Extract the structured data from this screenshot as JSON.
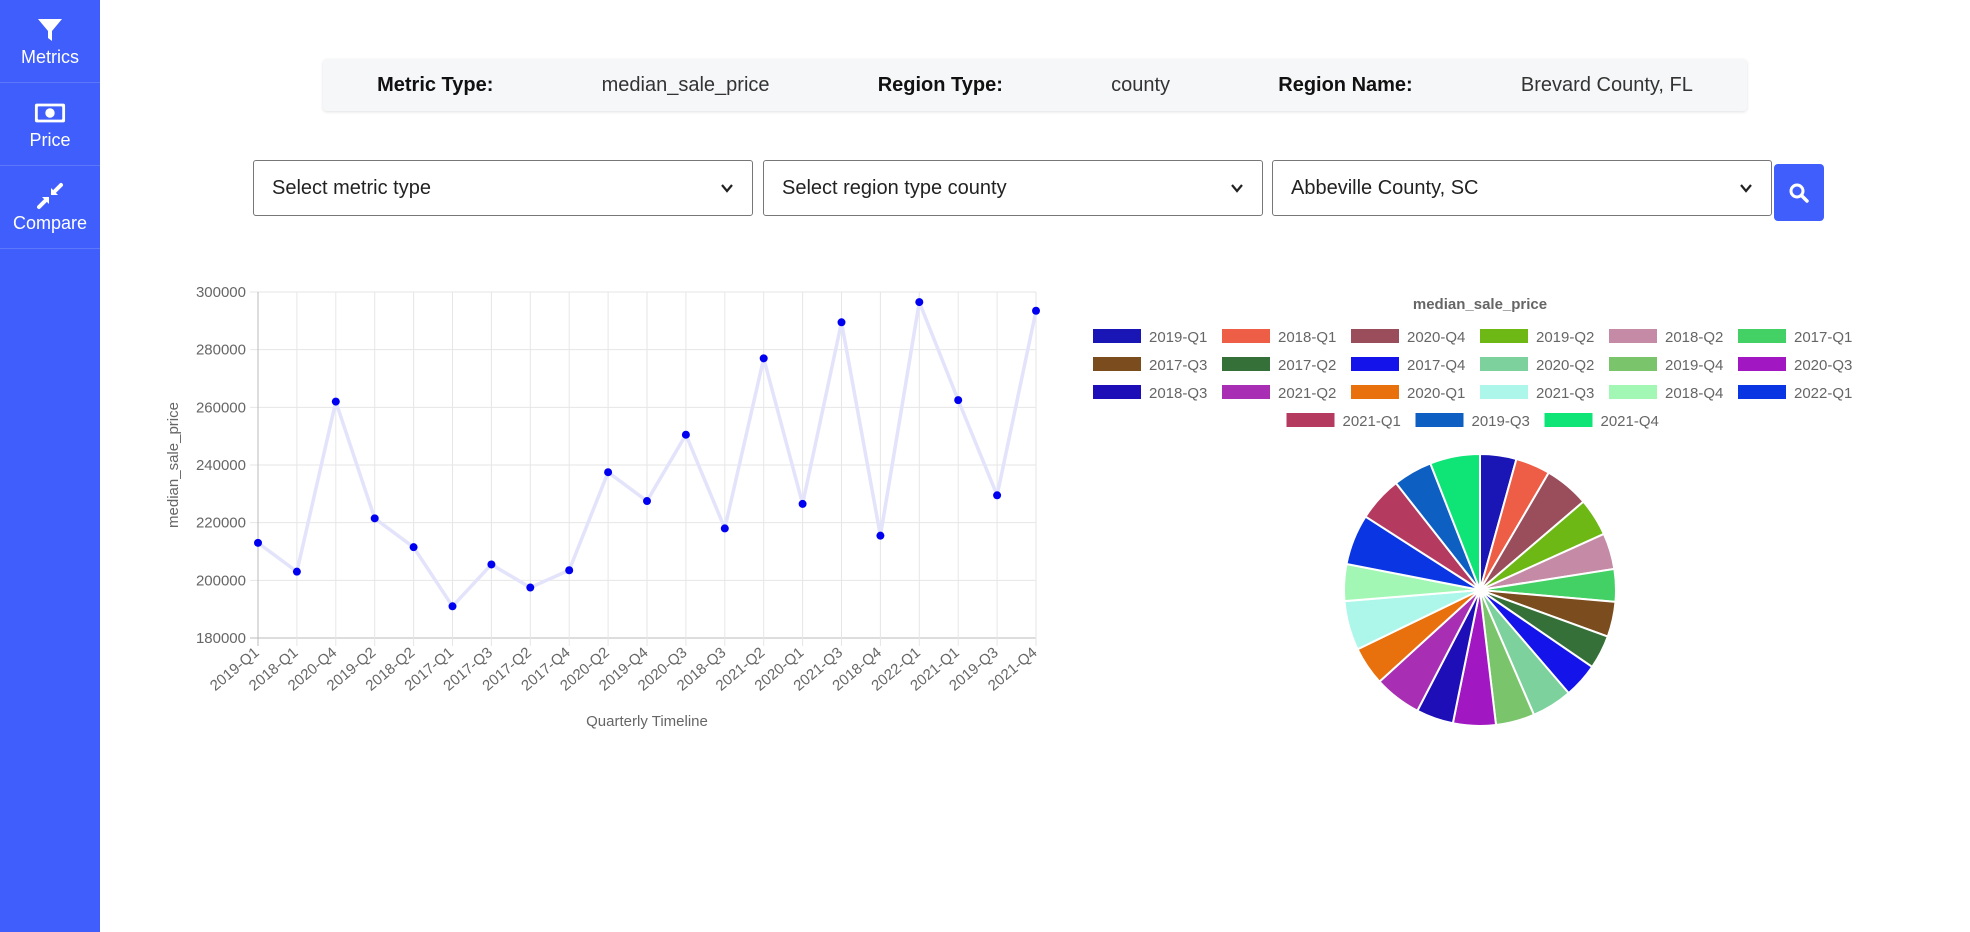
{
  "sidebar": {
    "items": [
      {
        "label": "Metrics",
        "icon": "filter-icon"
      },
      {
        "label": "Price",
        "icon": "money-icon"
      },
      {
        "label": "Compare",
        "icon": "compress-icon"
      }
    ]
  },
  "info": {
    "metric_type_label": "Metric Type:",
    "metric_type_value": "median_sale_price",
    "region_type_label": "Region Type:",
    "region_type_value": "county",
    "region_name_label": "Region Name:",
    "region_name_value": "Brevard County, FL"
  },
  "filters": {
    "metric_select": "Select metric type",
    "region_type_select": "Select region type county",
    "region_name_select": "Abbeville County, SC",
    "search_icon": "search-icon"
  },
  "colors": {
    "sidebar": "#3f5efb",
    "line": "#e3e3fb",
    "points": "#0000f0"
  },
  "chart_data": [
    {
      "type": "line",
      "ylabel": "median_sale_price",
      "xlabel": "Quarterly Timeline",
      "ylim": [
        180000,
        300000
      ],
      "yticks": [
        180000,
        200000,
        220000,
        240000,
        260000,
        280000,
        300000
      ],
      "grid": true,
      "categories": [
        "2019-Q1",
        "2018-Q1",
        "2020-Q4",
        "2019-Q2",
        "2018-Q2",
        "2017-Q1",
        "2017-Q3",
        "2017-Q2",
        "2017-Q4",
        "2020-Q2",
        "2019-Q4",
        "2020-Q3",
        "2018-Q3",
        "2021-Q2",
        "2020-Q1",
        "2021-Q3",
        "2018-Q4",
        "2022-Q1",
        "2021-Q1",
        "2019-Q3",
        "2021-Q4"
      ],
      "values": [
        213000,
        203000,
        262000,
        221500,
        211500,
        191000,
        205500,
        197500,
        203500,
        237500,
        227500,
        250500,
        218000,
        277000,
        226500,
        289500,
        215500,
        296500,
        262500,
        229500,
        293500
      ]
    },
    {
      "type": "pie",
      "title": "median_sale_price",
      "legend_position": "top",
      "categories": [
        "2019-Q1",
        "2018-Q1",
        "2020-Q4",
        "2019-Q2",
        "2018-Q2",
        "2017-Q1",
        "2017-Q3",
        "2017-Q2",
        "2017-Q4",
        "2020-Q2",
        "2019-Q4",
        "2020-Q3",
        "2018-Q3",
        "2021-Q2",
        "2020-Q1",
        "2021-Q3",
        "2018-Q4",
        "2022-Q1",
        "2021-Q1",
        "2019-Q3",
        "2021-Q4"
      ],
      "values": [
        213000,
        203000,
        262000,
        221500,
        211500,
        191000,
        205500,
        197500,
        203500,
        237500,
        227500,
        250500,
        218000,
        277000,
        226500,
        289500,
        215500,
        296500,
        262500,
        229500,
        293500
      ],
      "colors": [
        "#1a16b5",
        "#ee5d45",
        "#9a4e5c",
        "#6db815",
        "#c48aa6",
        "#43d165",
        "#7b4c1e",
        "#357038",
        "#1414ea",
        "#7cd19c",
        "#7ac46b",
        "#a117c2",
        "#1d0eb8",
        "#a82fb3",
        "#e8700d",
        "#adf7ea",
        "#a3f7b5",
        "#0a35e3",
        "#b53a60",
        "#0e5fc2",
        "#0fe477"
      ]
    }
  ]
}
